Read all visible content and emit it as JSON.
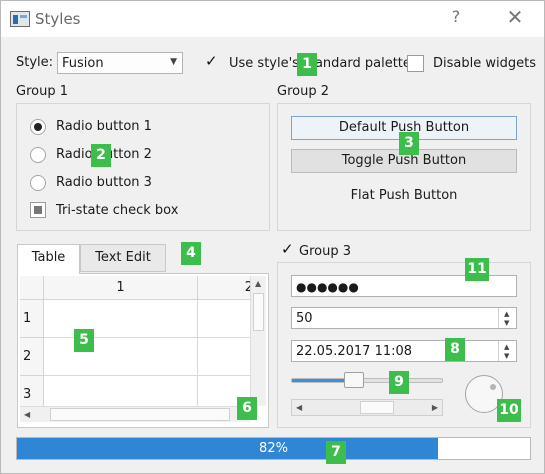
{
  "window": {
    "title": "Styles",
    "help_glyph": "?",
    "close_glyph": "✕"
  },
  "top_bar": {
    "style_label": "Style:",
    "style_value": "Fusion",
    "standard_palette_label": "Use style's standard palette",
    "standard_palette_checked": true,
    "disable_widgets_label": "Disable widgets",
    "disable_widgets_checked": false
  },
  "group1": {
    "title": "Group 1",
    "radios": [
      {
        "label": "Radio button 1",
        "checked": true
      },
      {
        "label": "Radio button 2",
        "checked": false
      },
      {
        "label": "Radio button 3",
        "checked": false
      }
    ],
    "tristate_label": "Tri-state check box"
  },
  "group2": {
    "title": "Group 2",
    "default_button": "Default Push Button",
    "toggle_button": "Toggle Push Button",
    "flat_button": "Flat Push Button"
  },
  "tabs": {
    "items": [
      "Table",
      "Text Edit"
    ],
    "active": "Table",
    "table": {
      "columns": [
        "1",
        "2"
      ],
      "rows": [
        "1",
        "2",
        "3"
      ]
    }
  },
  "group3": {
    "title": "Group 3",
    "checked": true,
    "password": "●●●●●●",
    "spin_value": "50",
    "datetime": "22.05.2017 11:08",
    "slider_fraction": 0.4
  },
  "progress": {
    "percent": 82,
    "text": "82%"
  },
  "annotations": [
    "1",
    "2",
    "3",
    "4",
    "5",
    "6",
    "7",
    "8",
    "9",
    "10",
    "11"
  ],
  "colors": {
    "accent": "#2f86d4",
    "badge": "#3dbd4c"
  }
}
